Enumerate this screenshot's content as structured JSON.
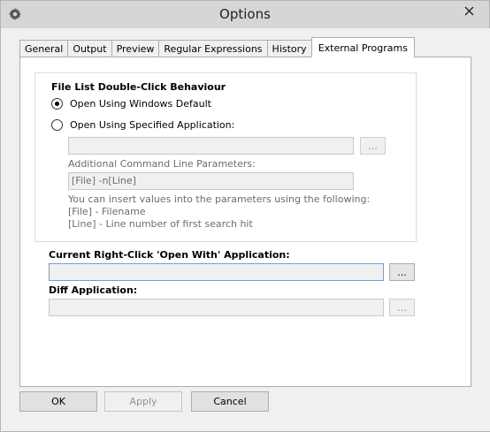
{
  "window": {
    "title": "Options",
    "icon": "gear-icon",
    "close_icon": "close-icon"
  },
  "tabs": [
    {
      "label": "General",
      "active": false
    },
    {
      "label": "Output",
      "active": false
    },
    {
      "label": "Preview",
      "active": false
    },
    {
      "label": "Regular Expressions",
      "active": false
    },
    {
      "label": "History",
      "active": false
    },
    {
      "label": "External Programs",
      "active": true
    }
  ],
  "double_click": {
    "title": "File List Double-Click Behaviour",
    "option_default": "Open Using Windows Default",
    "option_specified": "Open Using Specified Application:",
    "selected": "default",
    "app_path_value": "",
    "browse_label": "...",
    "params_label": "Additional Command Line Parameters:",
    "params_value": "[File] -n[Line]",
    "help_line_1": "You can insert values into the parameters using the following:",
    "help_line_2": "[File] - Filename",
    "help_line_3": "[Line] - Line number of first search hit"
  },
  "open_with": {
    "label": "Current Right-Click 'Open With' Application:",
    "value": "",
    "browse_label": "..."
  },
  "diff": {
    "label": "Diff Application:",
    "value": "",
    "browse_label": "..."
  },
  "buttons": {
    "ok": "OK",
    "apply": "Apply",
    "cancel": "Cancel"
  }
}
